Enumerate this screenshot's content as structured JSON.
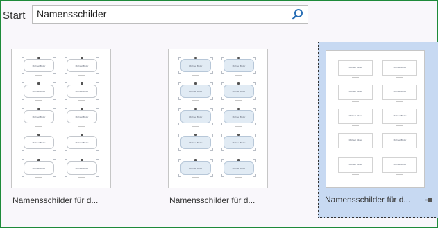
{
  "header": {
    "start_label": "Start",
    "search_value": "Namensschilder",
    "search_icon": "search-icon"
  },
  "templates": [
    {
      "caption": "Namensschilder für d...",
      "badge_text": "Michael Bilder",
      "style": "outline",
      "selected": false
    },
    {
      "caption": "Namensschilder für d...",
      "badge_text": "Michael Bilder",
      "style": "filled",
      "selected": false
    },
    {
      "caption": "Namensschilder für d...",
      "badge_text": "Michael Bilder",
      "style": "plain",
      "selected": true,
      "pin_icon": "pin-icon"
    }
  ],
  "colors": {
    "frame_border": "#1e8a3a",
    "selected_bg": "#c7d9f2",
    "search_icon": "#2a6fb6"
  }
}
